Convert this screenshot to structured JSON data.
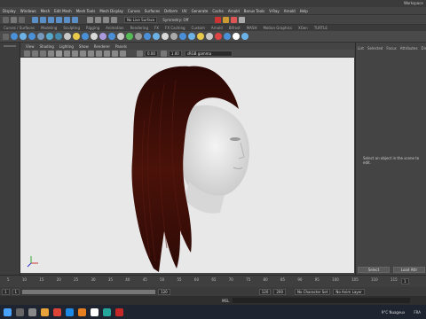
{
  "window": {
    "title": "Workspace"
  },
  "menu": [
    "Display",
    "Windows",
    "Mesh",
    "Edit Mesh",
    "Mesh Tools",
    "Mesh Display",
    "Curves",
    "Surfaces",
    "Deform",
    "UV",
    "Generate",
    "Cache",
    "Arnold",
    "Bonus Tools",
    "V-Ray",
    "Arnold",
    "Help"
  ],
  "status": {
    "surface": "No Live Surface",
    "symmetry": "Symmetry: Off"
  },
  "shelf_tabs": [
    "Curves / Surfaces",
    "Modeling",
    "Sculpting",
    "Rigging",
    "Animation",
    "Rendering",
    "FX",
    "FX Caching",
    "Custom",
    "Arnold",
    "Bifrost",
    "MASH",
    "Motion Graphics",
    "XGen",
    "TURTLE"
  ],
  "viewport": {
    "menu": [
      "View",
      "Shading",
      "Lighting",
      "Show",
      "Renderer",
      "Panels"
    ],
    "exposure": "0.00",
    "gamma": "1.00",
    "colorspace": "sRGB gamma"
  },
  "right_panel": {
    "tabs": [
      "List",
      "Selected",
      "Focus",
      "Attributes",
      "Display"
    ],
    "message": "Select an object in the scene to edit.",
    "select_btn": "Select",
    "load_btn": "Load Attr"
  },
  "timeline": {
    "ticks": [
      "5",
      "10",
      "15",
      "20",
      "25",
      "30",
      "35",
      "40",
      "45",
      "50",
      "55",
      "60",
      "65",
      "70",
      "75",
      "80",
      "85",
      "90",
      "95",
      "100",
      "105",
      "110",
      "115"
    ],
    "current": "1"
  },
  "range": {
    "start": "1",
    "start2": "1",
    "end_inner": "120",
    "end": "120",
    "end2": "200",
    "char_set": "No Character Set",
    "anim_layer": "No Anim Layer"
  },
  "mel": {
    "label": "MEL"
  },
  "taskbar": {
    "weather": "9°C Nuageux",
    "lang": "FRA"
  },
  "colors": {
    "hair": "#3a0d08",
    "viewport_bg": "#e8e8e8",
    "accent": "#3b6ea5"
  }
}
